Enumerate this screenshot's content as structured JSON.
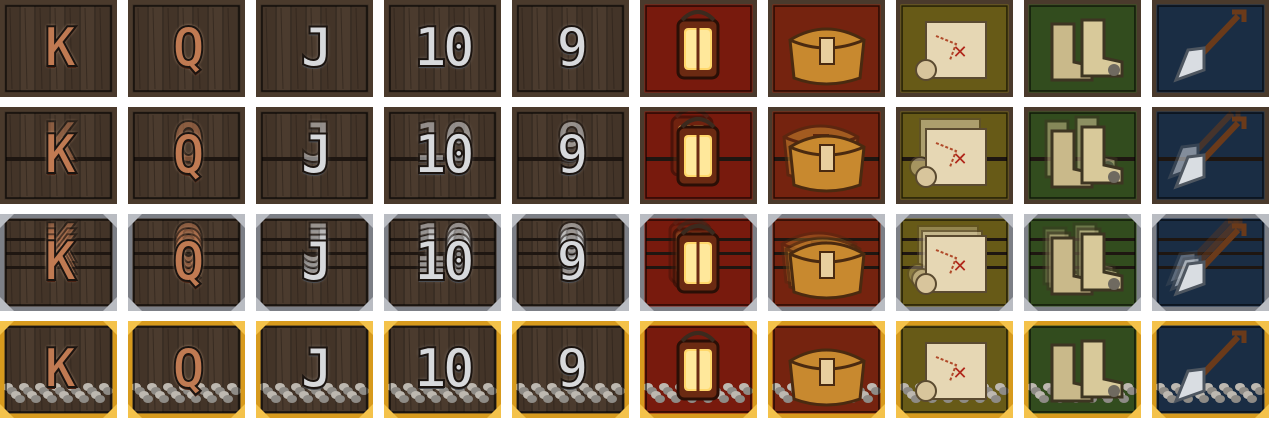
{
  "sheet": {
    "columns": [
      {
        "kind": "letter",
        "label": "K",
        "finish": "rust"
      },
      {
        "kind": "letter",
        "label": "Q",
        "finish": "rust"
      },
      {
        "kind": "letter",
        "label": "J",
        "finish": "metal"
      },
      {
        "kind": "letter",
        "label": "10",
        "finish": "metal"
      },
      {
        "kind": "letter",
        "label": "9",
        "finish": "metal"
      },
      {
        "kind": "icon",
        "icon": "lantern-icon",
        "bg": "#8e1f10"
      },
      {
        "kind": "icon",
        "icon": "satchel-icon",
        "bg": "#8a2a12"
      },
      {
        "kind": "icon",
        "icon": "map-scroll-icon",
        "bg": "#7a6a1c"
      },
      {
        "kind": "icon",
        "icon": "boots-icon",
        "bg": "#3b5a24"
      },
      {
        "kind": "icon",
        "icon": "shovel-icon",
        "bg": "#1f3550"
      }
    ],
    "rows": [
      {
        "variant": "plain",
        "frame": "#4a3a2c"
      },
      {
        "variant": "double",
        "frame": "#4a3a2c"
      },
      {
        "variant": "stacked",
        "frame": "#7c7f86"
      },
      {
        "variant": "gold",
        "frame": "#d79a1d"
      }
    ]
  }
}
